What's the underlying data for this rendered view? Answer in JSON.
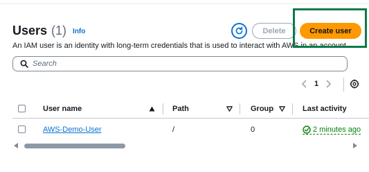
{
  "header": {
    "title": "Users",
    "count": "(1)",
    "info": "Info",
    "description": "An IAM user is an identity with long-term credentials that is used to interact with AWS in an account."
  },
  "actions": {
    "refresh_icon": "refresh-icon",
    "delete_label": "Delete",
    "create_label": "Create user"
  },
  "search": {
    "placeholder": "Search",
    "value": ""
  },
  "pagination": {
    "current_page": "1"
  },
  "table": {
    "columns": [
      "User name",
      "Path",
      "Groups",
      "Last activity"
    ],
    "rows": [
      {
        "user_name": "AWS-Demo-User",
        "path": "/",
        "groups": "0",
        "last_activity": "2 minutes ago"
      }
    ]
  },
  "colors": {
    "accent": "#0972d3",
    "primary_button": "#ff9900",
    "success": "#037f0c",
    "highlight": "#0b7a4b"
  }
}
